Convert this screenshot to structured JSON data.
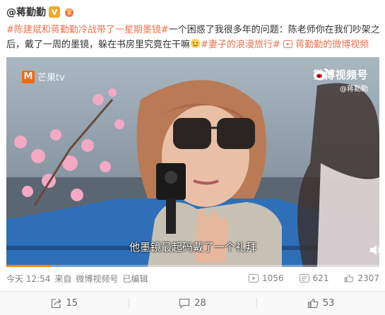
{
  "post": {
    "author": "@蒋勤勤",
    "verified_badge": "V",
    "text": {
      "topic1": "#陈建斌和蒋勤勤冷战带了一星期墨镜#",
      "body": "一个困惑了我很多年的问题：陈老师你在我们吵架之后，戴了一周的墨镜，躲在书房里究竟在干嘛",
      "topic2": "#妻子的浪漫旅行#",
      "link": "蒋勤勤的微博视频"
    },
    "meta": {
      "time": "今天 12:54",
      "source_prefix": "来自",
      "source": "微博视频号",
      "edited": "已编辑"
    },
    "stats": {
      "views": "1056",
      "comments_count": "621",
      "likes_count": "2307"
    }
  },
  "video": {
    "mango_logo": "芒果tv",
    "weibo_logo": "微博视频号",
    "weibo_handle": "@蒋勤勤",
    "subtitle": "他墨镜最起码戴了一个礼拜",
    "progress": 0.12
  },
  "actions": {
    "share": "15",
    "comment": "28",
    "like": "53"
  },
  "colors": {
    "accent": "#eb7350",
    "badge": "#f5a623",
    "progress": "#ff8200"
  }
}
